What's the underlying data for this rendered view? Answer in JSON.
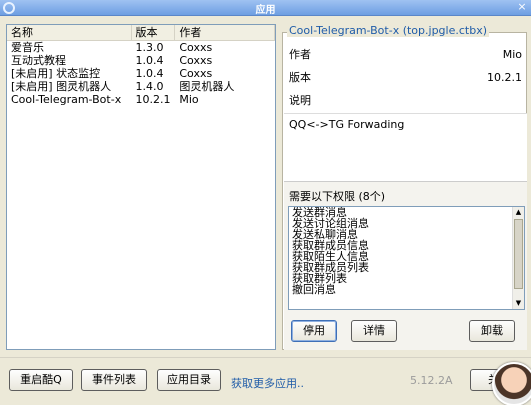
{
  "window": {
    "title": "应用",
    "close_label": "×"
  },
  "plugin_list": {
    "headers": {
      "name": "名称",
      "version": "版本",
      "author": "作者"
    },
    "rows": [
      {
        "name": "爱音乐",
        "version": "1.3.0",
        "author": "Coxxs"
      },
      {
        "name": "互动式教程",
        "version": "1.0.4",
        "author": "Coxxs"
      },
      {
        "name": "[未启用] 状态监控",
        "version": "1.0.4",
        "author": "Coxxs"
      },
      {
        "name": "[未启用] 图灵机器人",
        "version": "1.4.0",
        "author": "图灵机器人"
      },
      {
        "name": "Cool-Telegram-Bot-x",
        "version": "10.2.1",
        "author": "Mio"
      }
    ]
  },
  "details": {
    "title": "Cool-Telegram-Bot-x (top.jpgle.ctbx)",
    "author_label": "作者",
    "author_value": "Mio",
    "version_label": "版本",
    "version_value": "10.2.1",
    "desc_label": "说明",
    "description": "QQ<->TG Forwading",
    "permissions_title": "需要以下权限 (8个)",
    "permissions": [
      "发送群消息",
      "发送讨论组消息",
      "发送私聊消息",
      "获取群成员信息",
      "获取陌生人信息",
      "获取群成员列表",
      "获取群列表",
      "撤回消息"
    ],
    "buttons": {
      "disable": "停用",
      "details": "详情",
      "uninstall": "卸载"
    }
  },
  "footer": {
    "restart": "重启酷Q",
    "events": "事件列表",
    "app_dir": "应用目录",
    "more_apps": "获取更多应用..",
    "version": "5.12.2A",
    "close": "关闭"
  }
}
